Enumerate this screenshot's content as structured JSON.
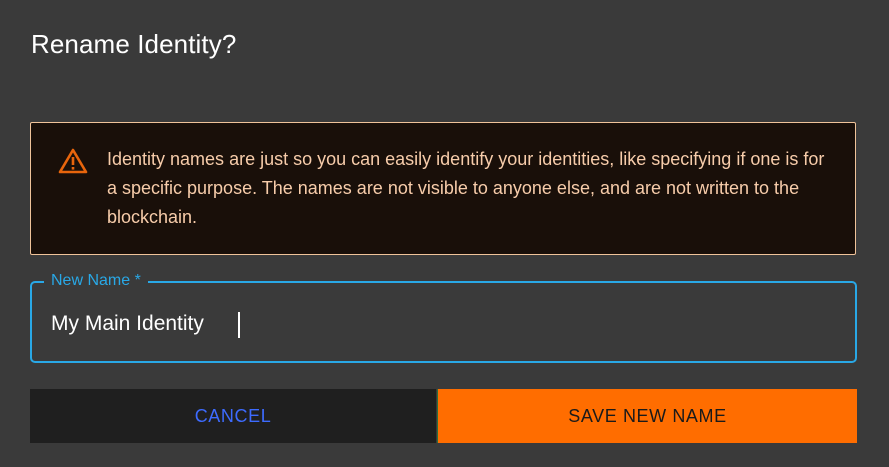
{
  "dialog": {
    "title": "Rename Identity?",
    "warning": {
      "icon": "warning-triangle-icon",
      "text": "Identity names are just so you can easily identify your identities, like specifying if one is for a specific purpose. The names are not visible to anyone else, and are not written to the blockchain."
    },
    "field": {
      "label": "New Name *",
      "value": "My Main Identity"
    },
    "buttons": {
      "cancel": "Cancel",
      "save": "Save New Name"
    }
  },
  "colors": {
    "background": "#3a3a3a",
    "warning_border": "#f0c39a",
    "warning_background": "#190f09",
    "warning_text": "#f7ccaa",
    "warning_icon": "#e8650c",
    "field_accent": "#29a8e6",
    "cancel_text": "#3d6bff",
    "save_background": "#ff6d00"
  }
}
